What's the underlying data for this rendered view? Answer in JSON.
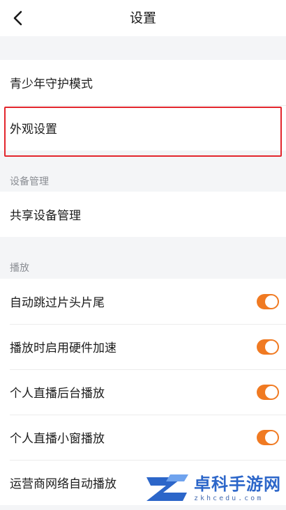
{
  "header": {
    "title": "设置",
    "back_icon": "chevron-left-icon"
  },
  "group1": {
    "items": [
      {
        "label": "青少年守护模式"
      },
      {
        "label": "外观设置"
      }
    ]
  },
  "device": {
    "section_label": "设备管理",
    "items": [
      {
        "label": "共享设备管理"
      }
    ]
  },
  "playback": {
    "section_label": "播放",
    "items": [
      {
        "label": "自动跳过片头片尾",
        "enabled": true
      },
      {
        "label": "播放时启用硬件加速",
        "enabled": true
      },
      {
        "label": "个人直播后台播放",
        "enabled": true
      },
      {
        "label": "个人直播小窗播放",
        "enabled": true
      },
      {
        "label": "运营商网络自动播放",
        "enabled": true
      }
    ]
  },
  "colors": {
    "accent": "#f07a22",
    "highlight": "#e3262d",
    "watermark": "#2c66c9"
  },
  "watermark": {
    "title": "卓科手游网",
    "sub": "zkhcedu.com"
  }
}
